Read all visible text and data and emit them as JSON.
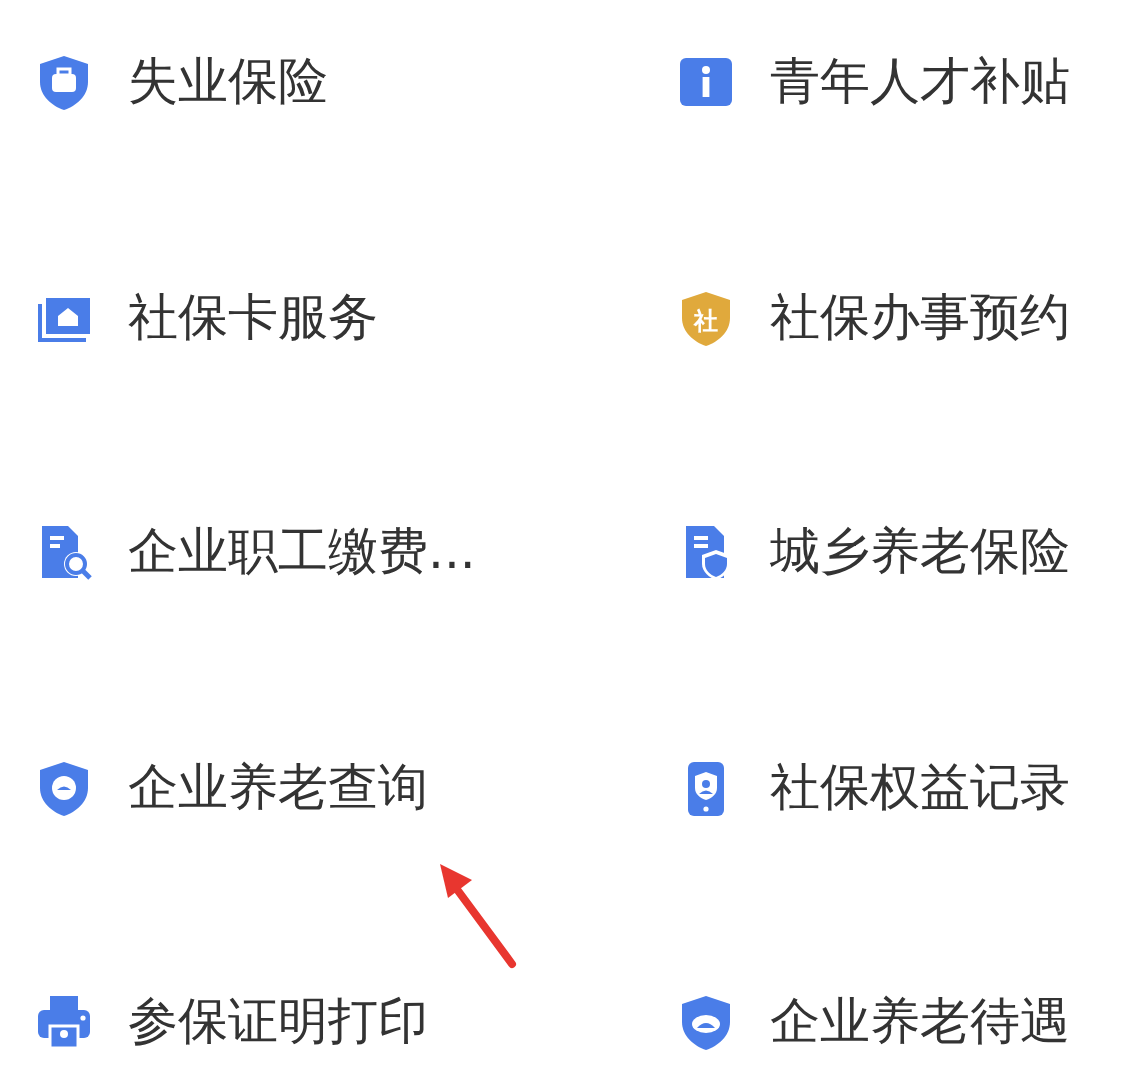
{
  "items": [
    {
      "label": "失业保险",
      "kind": "shield-briefcase",
      "color": "#4a7de8"
    },
    {
      "label": "青年人才补贴",
      "kind": "info",
      "color": "#4a7de8"
    },
    {
      "label": "社保卡服务",
      "kind": "card-house",
      "color": "#4a7de8"
    },
    {
      "label": "社保办事预约",
      "kind": "shield-text",
      "color": "#e0a93c",
      "icon_label": "社"
    },
    {
      "label": "企业职工缴费...",
      "kind": "doc-search",
      "color": "#4a7de8"
    },
    {
      "label": "城乡养老保险",
      "kind": "doc-shield",
      "color": "#4a7de8"
    },
    {
      "label": "企业养老查询",
      "kind": "shield-face",
      "color": "#4a7de8"
    },
    {
      "label": "社保权益记录",
      "kind": "phone-person",
      "color": "#4a7de8"
    },
    {
      "label": "参保证明打印",
      "kind": "printer",
      "color": "#4a7de8"
    },
    {
      "label": "企业养老待遇",
      "kind": "shield-smile",
      "color": "#4a7de8"
    }
  ],
  "annotation": {
    "kind": "arrow",
    "color": "#e8362f"
  }
}
